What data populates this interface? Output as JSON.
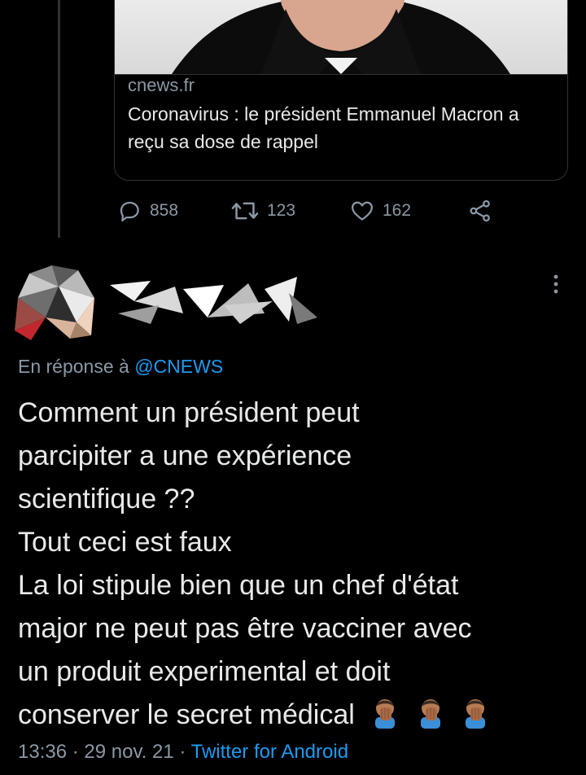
{
  "link_card": {
    "image_description": "portrait photo",
    "domain": "cnews.fr",
    "title": "Coronavirus : le président Emmanuel Macron a reçu sa dose de rappel"
  },
  "actions": {
    "replies": "858",
    "retweets": "123",
    "likes": "162"
  },
  "reply": {
    "replying_to_label": "En réponse à",
    "replying_to_handle": "@CNEWS",
    "text_lines": [
      "Comment un président peut",
      "parcipiter a une expérience",
      "scientifique ??",
      "Tout ceci est faux",
      "La loi stipule bien que un chef d'état",
      "major ne peut pas être vacciner avec",
      "un produit experimental et doit",
      "conserver le secret médical"
    ],
    "emoji": [
      "man-facepalming",
      "man-facepalming",
      "man-facepalming"
    ],
    "time": "13:36",
    "separator": "·",
    "date": "29 nov. 21",
    "source": "Twitter for Android"
  },
  "colors": {
    "background": "#000000",
    "text": "#e7e9ea",
    "muted": "#8b98a5",
    "link": "#1d9bf0",
    "border": "#2f3336"
  }
}
